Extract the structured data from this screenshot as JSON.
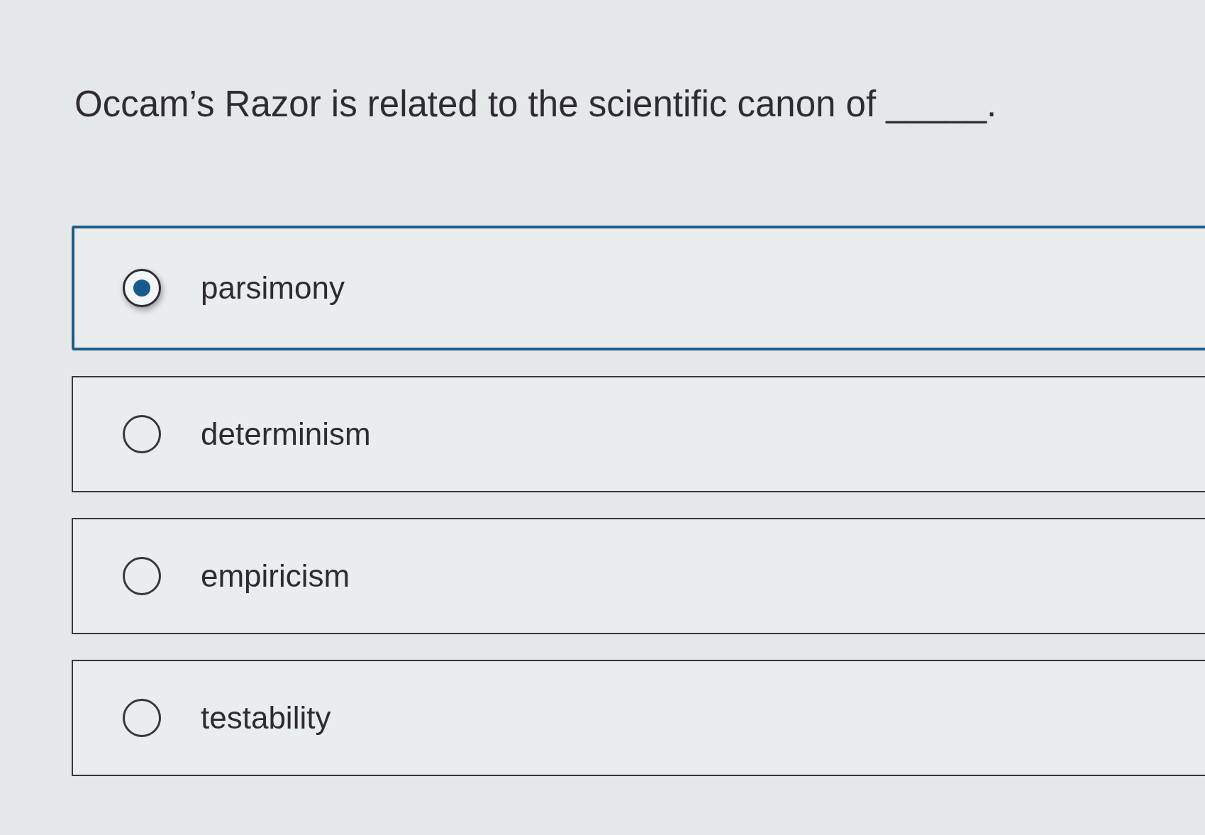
{
  "question": {
    "text": "Occam’s Razor is related to the scientific canon of _____."
  },
  "options": [
    {
      "label": "parsimony",
      "selected": true
    },
    {
      "label": "determinism",
      "selected": false
    },
    {
      "label": "empiricism",
      "selected": false
    },
    {
      "label": "testability",
      "selected": false
    }
  ]
}
